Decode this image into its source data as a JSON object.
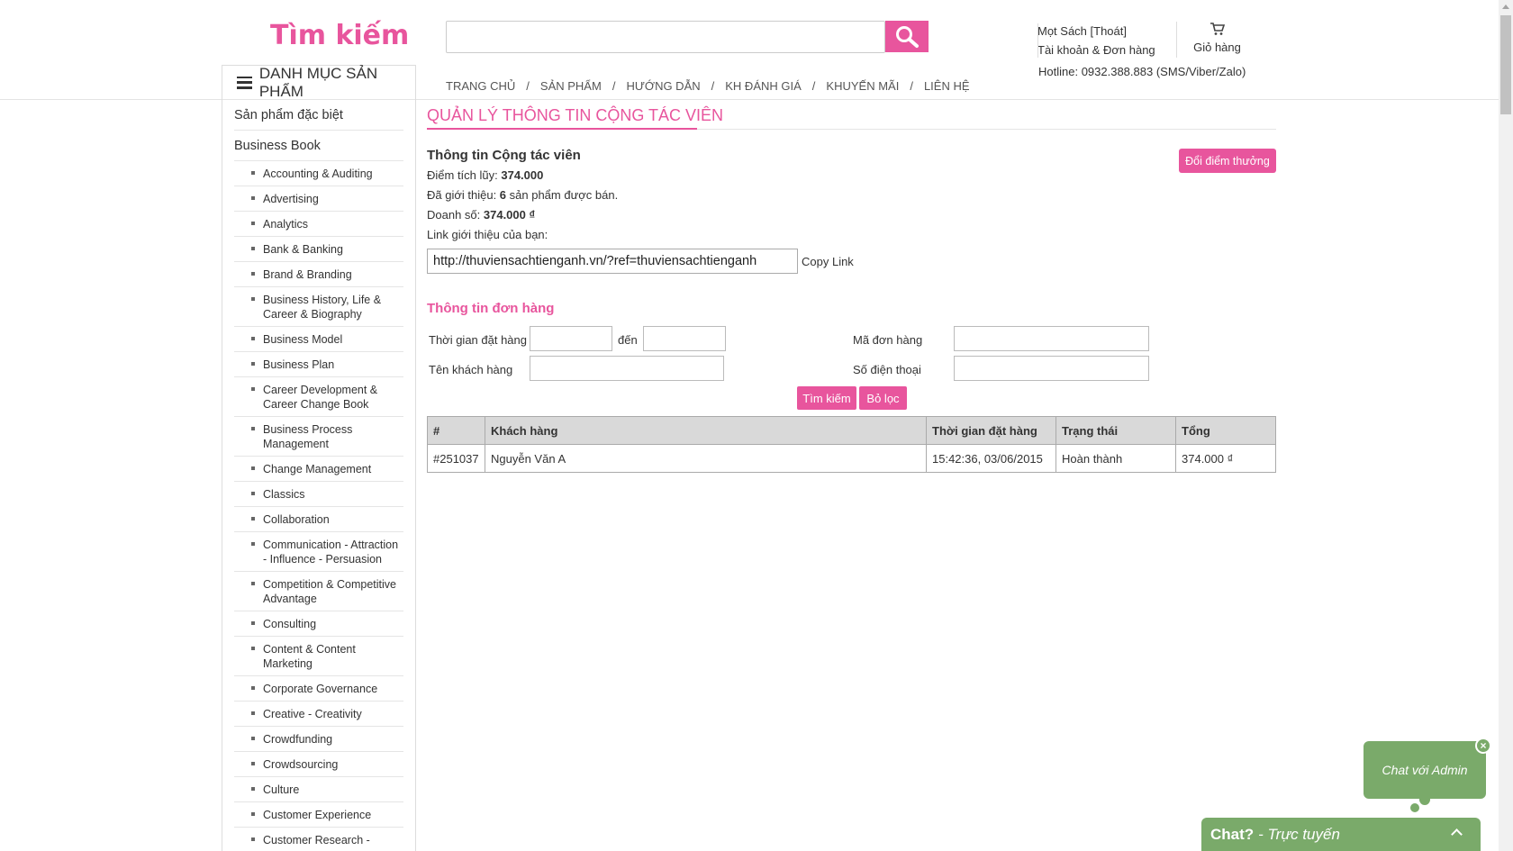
{
  "header": {
    "logo": "Tìm kiếm",
    "search": {
      "placeholder": "",
      "value": ""
    },
    "account": {
      "user_line": "Mọt Sách [Thoát]",
      "orders_link": "Tài khoản & Đơn hàng"
    },
    "cart_label": "Giỏ hàng",
    "hotline": "Hotline: 0932.388.883 (SMS/Viber/Zalo)",
    "nav": [
      "TRANG CHỦ",
      "SẢN PHẨM",
      "HƯỚNG DẪN",
      "KH ĐÁNH GIÁ",
      "KHUYẾN MÃI",
      "LIÊN HỆ"
    ],
    "nav_separator": "/"
  },
  "sidebar": {
    "title": "DANH MỤC SẢN PHẨM",
    "top_items": [
      "Sản phẩm đặc biệt",
      "Business Book"
    ],
    "sub_items": [
      "Accounting & Auditing",
      "Advertising",
      "Analytics",
      "Bank & Banking",
      "Brand & Branding",
      "Business History, Life & Career & Biography",
      "Business Model",
      "Business Plan",
      "Career Development & Career Change Book",
      "Business Process Management",
      "Change Management",
      "Classics",
      "Collaboration",
      "Communication - Attraction - Influence - Persuasion",
      "Competition & Competitive Advantage",
      "Consulting",
      "Content & Content Marketing",
      "Corporate Governance",
      "Creative - Creativity",
      "Crowdfunding",
      "Crowdsourcing",
      "Culture",
      "Customer Experience",
      "Customer Research -"
    ]
  },
  "main": {
    "title": "QUẢN LÝ THÔNG TIN CỘNG TÁC VIÊN",
    "info_heading": "Thông tin Cộng tác viên",
    "redeem_button": "Đổi điểm thưởng",
    "points_label": "Điểm tích lũy: ",
    "points_value": "374.000",
    "referred_label": "Đã giới thiệu: ",
    "referred_count": "6",
    "referred_suffix": " sản phẩm được bán.",
    "sales_label": "Doanh số: ",
    "sales_value": "374.000 ₫",
    "link_label": "Link giới thiệu của bạn:",
    "ref_link": "http://thuviensachtienganh.vn/?ref=thuviensachtienganh",
    "copy_link": "Copy Link",
    "orders_heading": "Thông tin đơn hàng",
    "filter": {
      "order_time_label": "Thời gian đặt hàng",
      "to_label": "đến",
      "order_code_label": "Mã đơn hàng",
      "customer_label": "Tên khách hàng",
      "phone_label": "Số điện thoại",
      "search_button": "Tìm kiếm",
      "clear_button": "Bỏ lọc"
    },
    "table": {
      "headers": [
        "#",
        "Khách hàng",
        "Thời gian đặt hàng",
        "Trạng thái",
        "Tổng"
      ],
      "rows": [
        [
          "#251037",
          "Nguyễn Văn A",
          "15:42:36, 03/06/2015",
          "Hoàn thành",
          "374.000 ₫"
        ]
      ]
    }
  },
  "chat": {
    "bubble": "Chat với Admin",
    "close": "×",
    "bar_title": "Chat?",
    "bar_status": " - Trực tuyến"
  },
  "colors": {
    "accent": "#e8559d",
    "chat": "#7aaa6a"
  }
}
